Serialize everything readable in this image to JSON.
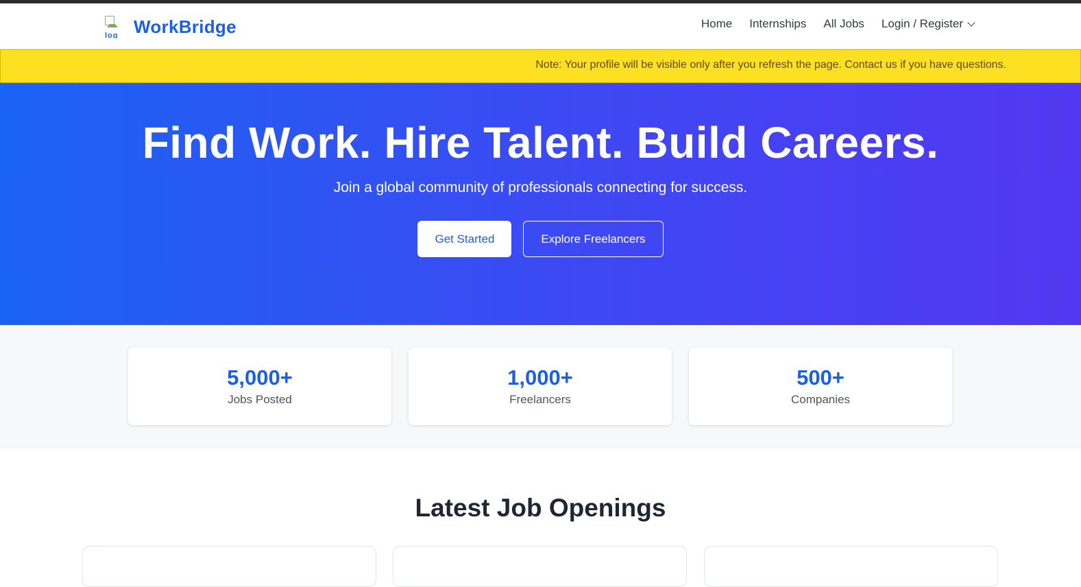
{
  "navbar": {
    "logo_alt": "log",
    "brand": "WorkBridge",
    "links": [
      {
        "label": "Home"
      },
      {
        "label": "Internships"
      },
      {
        "label": "All Jobs"
      },
      {
        "label": "Login / Register"
      }
    ]
  },
  "notice": {
    "text": "Note: Your profile will be visible only after you refresh the page. Contact us if you have questions."
  },
  "hero": {
    "title": "Find Work. Hire Talent. Build Careers.",
    "subtitle": "Join a global community of professionals connecting for success.",
    "primary_button": "Get Started",
    "secondary_button": "Explore Freelancers"
  },
  "stats": [
    {
      "value": "5,000+",
      "label": "Jobs Posted"
    },
    {
      "value": "1,000+",
      "label": "Freelancers"
    },
    {
      "value": "500+",
      "label": "Companies"
    }
  ],
  "jobs": {
    "title": "Latest Job Openings"
  },
  "colors": {
    "brand": "#1a5fe6",
    "notice_bg": "#fde021",
    "hero_gradient_start": "#1b63f2",
    "hero_gradient_end": "#5238f2"
  }
}
